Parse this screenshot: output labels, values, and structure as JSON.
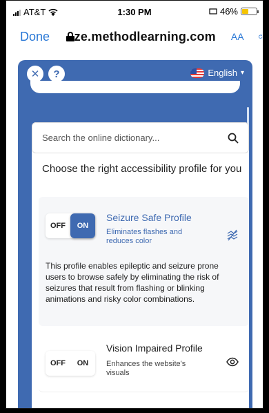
{
  "status_bar": {
    "carrier": "AT&T",
    "time": "1:30 PM",
    "battery": "46%"
  },
  "browser": {
    "done_label": "Done",
    "url": "ze.methodlearning.com",
    "aa_label": "AA"
  },
  "widget": {
    "close_label": "✕",
    "help_label": "?",
    "language": "English",
    "search_placeholder": "Search the online dictionary...",
    "headline": "Choose the right accessibility profile for you",
    "profiles": [
      {
        "title": "Seizure Safe Profile",
        "subtitle": "Eliminates flashes and reduces color",
        "off_label": "OFF",
        "on_label": "ON",
        "state": "on",
        "icon": "flash-off-icon",
        "description": "This profile enables epileptic and seizure prone users to browse safely by eliminating the risk of seizures that result from flashing or blinking animations and risky color combinations."
      },
      {
        "title": "Vision Impaired Profile",
        "subtitle": "Enhances the website's visuals",
        "off_label": "OFF",
        "on_label": "ON",
        "state": "off",
        "icon": "eye-icon"
      }
    ]
  },
  "colors": {
    "widget_blue": "#3f6ab1",
    "link_blue": "#2a78d6",
    "battery_yellow": "#f5c400"
  }
}
